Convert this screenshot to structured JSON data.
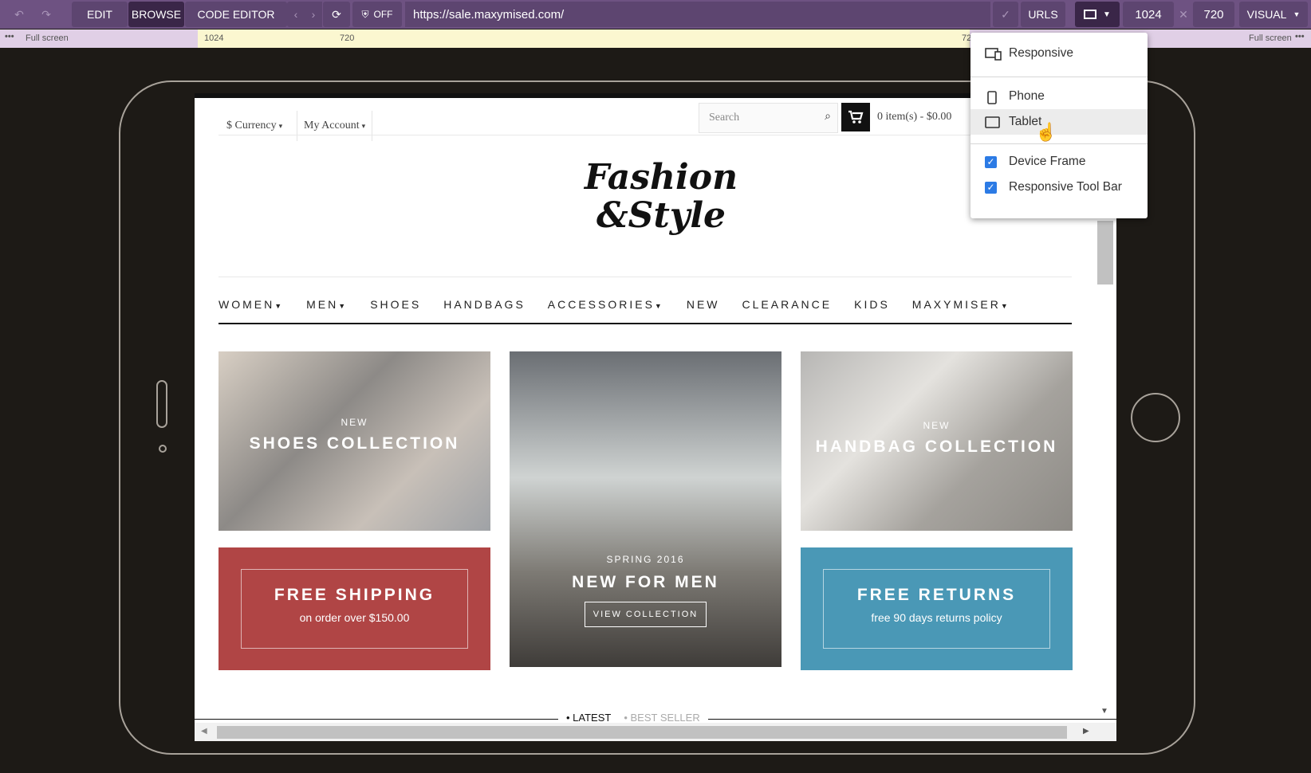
{
  "toolbar": {
    "edit": "EDIT",
    "browse": "BROWSE",
    "code_editor": "CODE EDITOR",
    "privacy": "OFF",
    "url": "https://sale.maxymised.com/",
    "urls": "URLS",
    "width": "1024",
    "times": "✕",
    "height": "720",
    "visual": "VISUAL",
    "icons": [
      "undo-icon",
      "redo-icon",
      "back-icon",
      "forward-icon",
      "reload-icon",
      "shield-icon",
      "check-icon",
      "device-icon",
      "chevron-down-icon"
    ]
  },
  "ruler": {
    "left_label": "Full screen",
    "right_label": "Full screen",
    "mark_1024": "1024",
    "mark_720": "720",
    "mark_72": "72"
  },
  "site": {
    "currency": "$ Currency",
    "account": "My Account",
    "search_placeholder": "Search",
    "cart": "0  item(s) - $0.00",
    "logo_line1": "Fashion",
    "logo_line2": "&Style",
    "nav": [
      "WOMEN",
      "MEN",
      "SHOES",
      "HANDBAGS",
      "ACCESSORIES",
      "NEW",
      "CLEARANCE",
      "KIDS",
      "MAXYMISER"
    ],
    "tiles": {
      "shoes_small": "NEW",
      "shoes_big": "SHOES COLLECTION",
      "men_small": "SPRING 2016",
      "men_big": "NEW FOR MEN",
      "men_button": "VIEW COLLECTION",
      "bags_small": "NEW",
      "bags_big": "HANDBAG COLLECTION",
      "ship_big": "FREE SHIPPING",
      "ship_small": "on order over $150.00",
      "ret_big": "FREE RETURNS",
      "ret_small": "free 90 days returns policy"
    },
    "tabs": [
      "LATEST",
      "BEST SELLER"
    ]
  },
  "menu": {
    "responsive": "Responsive",
    "phone": "Phone",
    "tablet": "Tablet",
    "device_frame": "Device Frame",
    "device_frame_checked": true,
    "responsive_toolbar": "Responsive Tool Bar",
    "responsive_toolbar_checked": true
  },
  "colors": {
    "toolbar": "#6e5282",
    "ship": "#b04545",
    "returns": "#4a98b6",
    "checkbox": "#2c7be5"
  }
}
